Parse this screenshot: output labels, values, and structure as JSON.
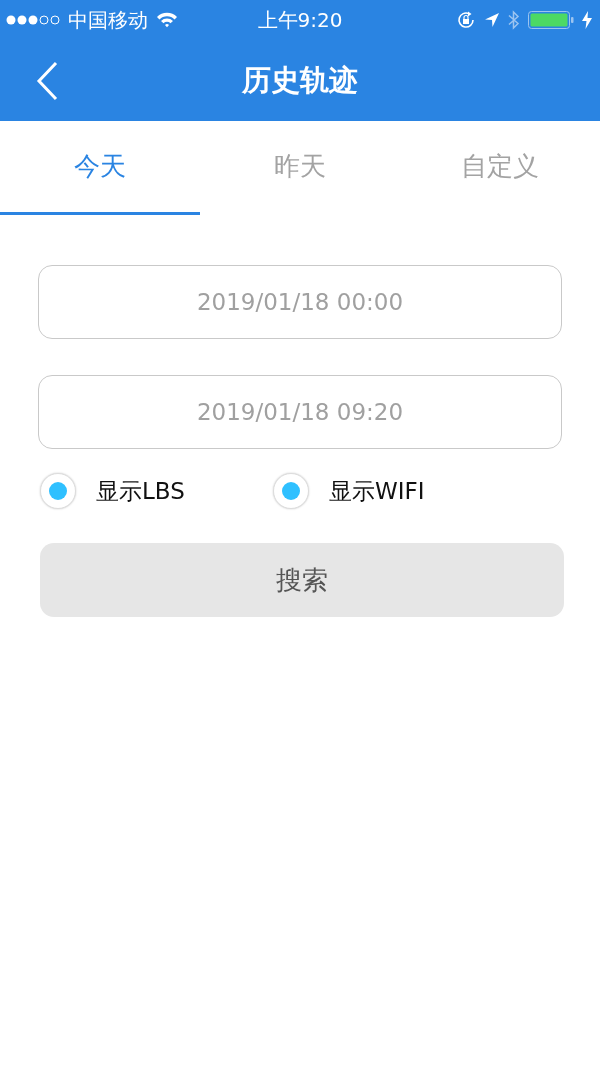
{
  "status_bar": {
    "carrier": "中国移动",
    "time": "上午9:20"
  },
  "nav_bar": {
    "title": "历史轨迹"
  },
  "tabs": [
    {
      "label": "今天",
      "selected": true
    },
    {
      "label": "昨天",
      "selected": false
    },
    {
      "label": "自定义",
      "selected": false
    }
  ],
  "fields": [
    {
      "value": "2019/01/18 00:00"
    },
    {
      "value": "2019/01/18 09:20"
    }
  ],
  "options": [
    {
      "label": "显示LBS",
      "checked": true
    },
    {
      "label": "显示WIFI",
      "checked": true
    }
  ],
  "search_button": {
    "label": "搜索"
  }
}
